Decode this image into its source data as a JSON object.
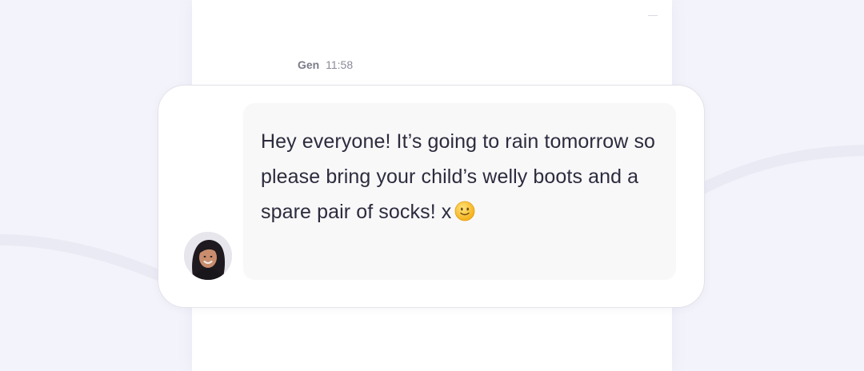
{
  "chat": {
    "sender_name": "Gen",
    "timestamp": "11:58",
    "message": "Hey everyone! It’s going to rain tomorrow so please bring your child’s welly boots and a spare pair of socks! x"
  },
  "icons": {
    "emoji": "slightly-smiling-face-icon",
    "minimize": "minimize-icon"
  },
  "colors": {
    "page_background": "#f3f3fb",
    "panel_background": "#ffffff",
    "bubble_background": "#f8f8f9",
    "message_text": "#2c2c3e",
    "meta_text": "#8a8a99"
  }
}
